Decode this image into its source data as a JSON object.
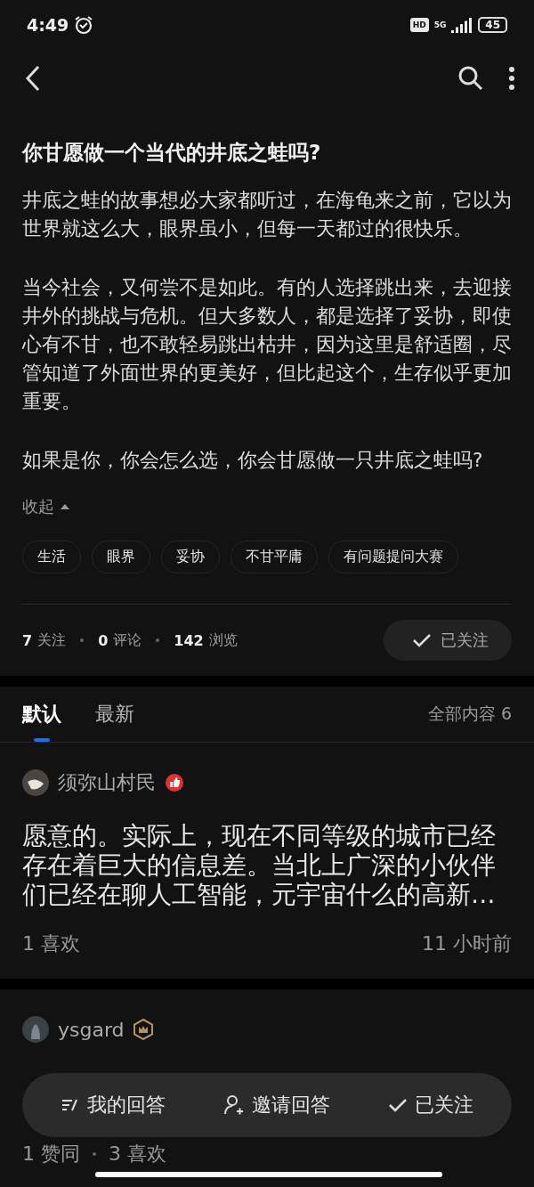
{
  "status_bar": {
    "time": "4:49",
    "hd": "HD",
    "network": "5G",
    "battery": "45"
  },
  "question": {
    "title": "你甘愿做一个当代的井底之蛙吗?",
    "paragraphs": [
      "井底之蛙的故事想必大家都听过，在海龟来之前，它以为世界就这么大，眼界虽小，但每一天都过的很快乐。",
      "当今社会，又何尝不是如此。有的人选择跳出来，去迎接井外的挑战与危机。但大多数人，都是选择了妥协，即使心有不甘，也不敢轻易跳出枯井，因为这里是舒适圈，尽管知道了外面世界的更美好，但比起这个，生存似乎更加重要。",
      "如果是你，你会怎么选，你会甘愿做一只井底之蛙吗?"
    ],
    "collapse": "收起",
    "tags": [
      "生活",
      "眼界",
      "妥协",
      "不甘平庸",
      "有问题提问大赛"
    ],
    "stats": [
      {
        "count": "7",
        "label": "关注"
      },
      {
        "count": "0",
        "label": "评论"
      },
      {
        "count": "142",
        "label": "浏览"
      }
    ],
    "follow_button": "已关注"
  },
  "tabs": [
    {
      "label": "默认",
      "selected": true
    },
    {
      "label": "最新",
      "selected": false
    }
  ],
  "total": "全部内容 6",
  "answers": [
    {
      "author": "须弥山村民",
      "kind": "thumb",
      "text": "愿意的。实际上，现在不同等级的城市已经存在着巨大的信息差。当北上广深的小伙伴们已经在聊人工智能，元宇宙什么的高新…",
      "footer": [
        "1  喜欢"
      ],
      "time": "11 小时前"
    },
    {
      "author": "ysgard",
      "kind": "crown",
      "footer": [
        "1  赞同",
        "3  喜欢"
      ]
    }
  ],
  "bottom_bar": [
    {
      "kind": "answer",
      "label": "我的回答"
    },
    {
      "kind": "invite",
      "label": "邀请回答"
    },
    {
      "kind": "follow",
      "label": "已关注"
    }
  ]
}
